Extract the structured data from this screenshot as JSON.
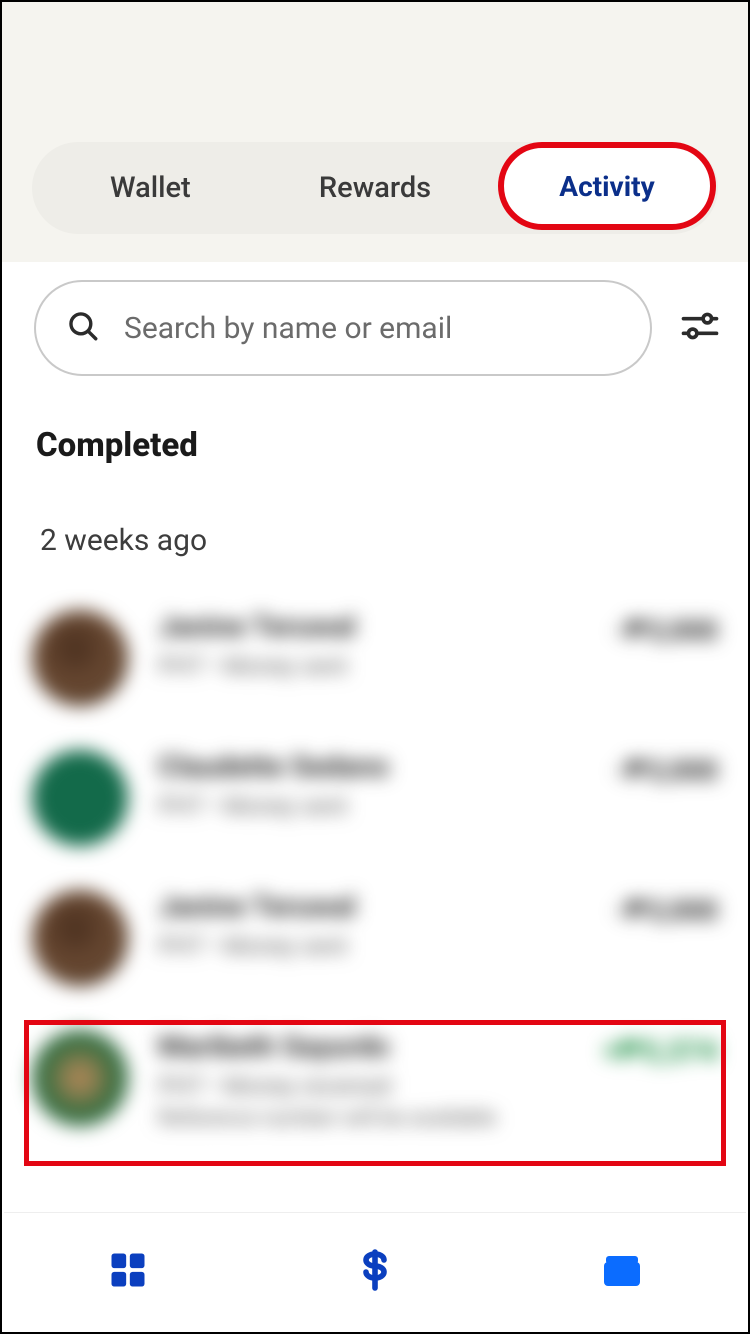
{
  "tabs": {
    "wallet": "Wallet",
    "rewards": "Rewards",
    "activity": "Activity"
  },
  "search": {
    "placeholder": "Search by name or email"
  },
  "section_title": "Completed",
  "date_label": "2 weeks ago",
  "transactions": [
    {
      "name": "Janine Teruwal",
      "sub": "PHT • Money sent",
      "amount": "-₱3,000"
    },
    {
      "name": "Claudette Sedano",
      "sub": "PHT • Money sent",
      "amount": "-₱3,000"
    },
    {
      "name": "Janine Teruwal",
      "sub": "PHT • Money sent",
      "amount": "-₱3,000"
    },
    {
      "name": "Maribeth Sayurdo",
      "sub": "PHT • Money received",
      "extra": "Reference number will be available",
      "amount": "+₱5,374",
      "positive": true
    }
  ],
  "colors": {
    "accent": "#0b2f8a",
    "highlight": "#e30613",
    "positive": "#0f8a3a"
  }
}
